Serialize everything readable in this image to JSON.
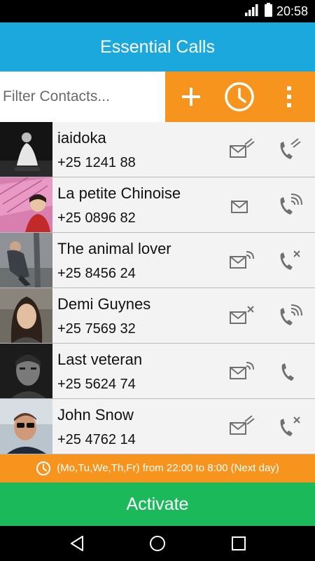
{
  "status_bar": {
    "time": "20:58",
    "icons": [
      "signal-icon",
      "battery-icon"
    ]
  },
  "app": {
    "title": "Essential Calls"
  },
  "filter": {
    "placeholder": "Filter Contacts...",
    "value": ""
  },
  "toolbar": {
    "icons": [
      "add-icon",
      "clock-icon",
      "more-vert-icon"
    ]
  },
  "contacts": [
    {
      "name": "iaidoka",
      "phone": "+25 1241 88",
      "sms_state": "muted",
      "call_state": "muted"
    },
    {
      "name": "La petite Chinoise",
      "phone": "+25 0896 82",
      "sms_state": "plain",
      "call_state": "ringing"
    },
    {
      "name": "The animal lover",
      "phone": "+25 8456 24",
      "sms_state": "ringing",
      "call_state": "blocked"
    },
    {
      "name": "Demi Guynes",
      "phone": "+25 7569 32",
      "sms_state": "blocked",
      "call_state": "ringing"
    },
    {
      "name": "Last veteran",
      "phone": "+25 5624 74",
      "sms_state": "ringing",
      "call_state": "plain"
    },
    {
      "name": "John Snow",
      "phone": "+25 4762 14",
      "sms_state": "muted",
      "call_state": "blocked"
    }
  ],
  "schedule": {
    "text": "(Mo,Tu,We,Th,Fr) from 22:00 to 8:00 (Next day)",
    "icon": "clock-icon"
  },
  "activate": {
    "label": "Activate"
  },
  "nav": {
    "icons": [
      "back-icon",
      "home-icon",
      "recents-icon"
    ]
  },
  "colors": {
    "app_bar": "#1ba8dc",
    "accent_orange": "#f7941d",
    "activate_green": "#1bb95a",
    "row_bg": "#f3f3f3",
    "icon_gray": "#707070"
  }
}
